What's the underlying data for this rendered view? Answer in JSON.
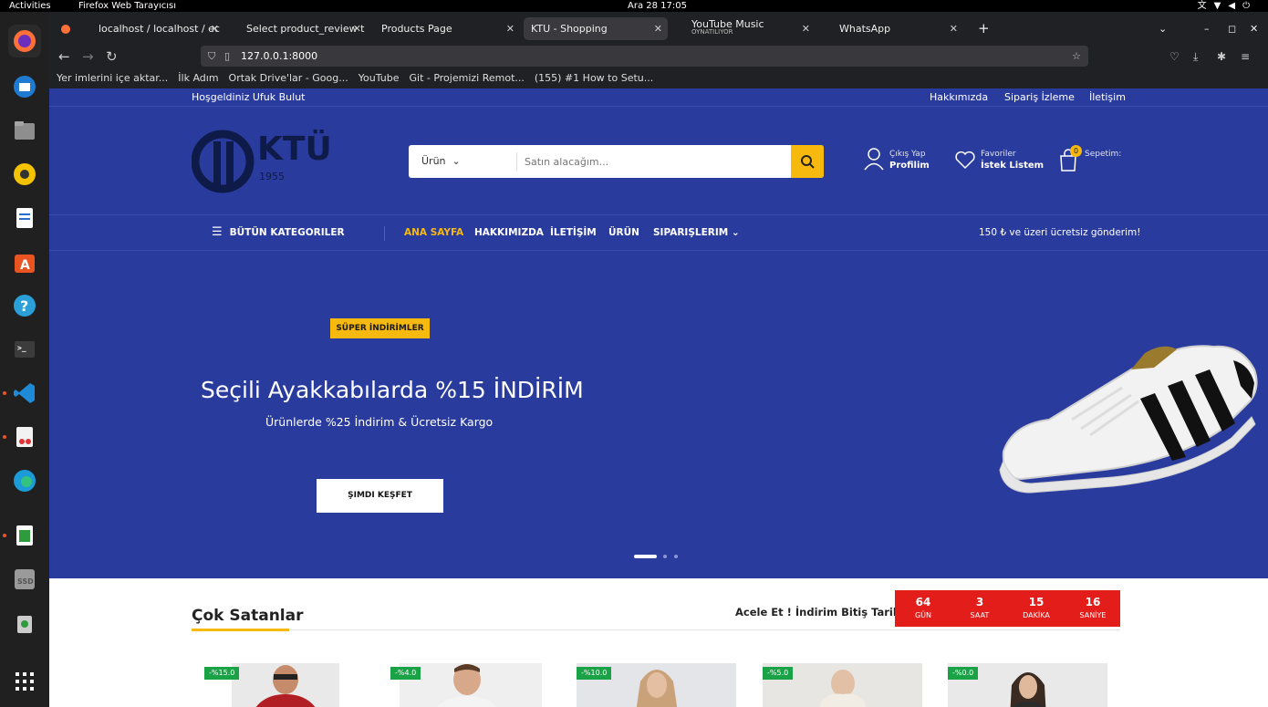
{
  "os": {
    "activities": "Activities",
    "app_name": "Firefox Web Tarayıcısı",
    "clock": "Ara 28  17:05"
  },
  "tabs": [
    {
      "label": "localhost / localhost / ec"
    },
    {
      "label": "Select product_review t"
    },
    {
      "label": "Products Page"
    },
    {
      "label": "KTU - Shopping"
    },
    {
      "label": "YouTube Music",
      "sub": "OYNATILIYOR"
    },
    {
      "label": "WhatsApp"
    }
  ],
  "url": "127.0.0.1:8000",
  "bookmarks": [
    "Yer imlerini içe aktar...",
    "İlk Adım",
    "Ortak Drive'lar - Goog...",
    "YouTube",
    "Git - Projemizi Remot...",
    "(155) #1 How to Setu..."
  ],
  "site": {
    "welcome": "Hoşgeldiniz Ufuk Bulut",
    "top_links": [
      "Hakkımızda",
      "Sipariş İzleme",
      "İletişim"
    ],
    "logo_text": "KTÜ",
    "logo_year": "1955",
    "search": {
      "category": "Ürün",
      "placeholder": "Satın alacağım..."
    },
    "account": {
      "line1": "Çıkış Yap",
      "line2": "Profilim"
    },
    "favorites": {
      "line1": "Favoriler",
      "line2": "İstek Listem"
    },
    "cart": {
      "count": "0",
      "label": "Sepetim:"
    },
    "all_categories": "BÜTÜN KATEGORILER",
    "menu": [
      "ANA SAYFA",
      "HAKKIMIZDA",
      "İLETİŞİM",
      "ÜRÜN",
      "SIPARIŞLERIM"
    ],
    "shipping_note": "150 ₺ ve üzeri ücretsiz gönderim!",
    "hero": {
      "badge": "SÜPER İNDİRİMLER",
      "title": "Seçili Ayakkabılarda %15 İNDİRİM",
      "subtitle": "Ürünlerde %25 İndirim & Ücretsiz Kargo",
      "button": "ŞIMDI KEŞFET"
    },
    "best_sellers": "Çok Satanlar",
    "deal_label": "Acele Et ! İndirim Bitiş Tarihi:",
    "countdown": [
      {
        "n": "64",
        "l": "GÜN"
      },
      {
        "n": "3",
        "l": "SAAT"
      },
      {
        "n": "15",
        "l": "DAKİKA"
      },
      {
        "n": "16",
        "l": "SANİYE"
      }
    ],
    "products": [
      {
        "discount": "-%15.0"
      },
      {
        "discount": "-%4.0"
      },
      {
        "discount": "-%10.0"
      },
      {
        "discount": "-%5.0"
      },
      {
        "discount": "-%0.0"
      }
    ]
  }
}
